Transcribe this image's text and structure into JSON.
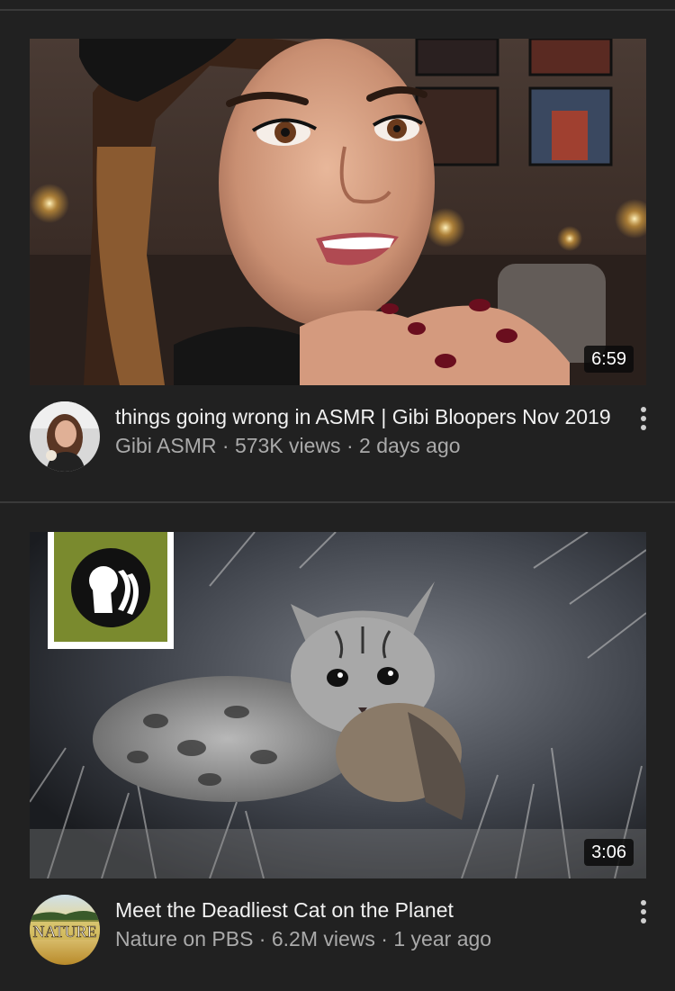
{
  "videos": [
    {
      "title": "things going wrong in ASMR | Gibi Bloopers Nov 2019",
      "channel": "Gibi ASMR",
      "views": "573K views",
      "age": "2 days ago",
      "duration": "6:59",
      "separator": " · ",
      "avatar_icon": "channel-avatar-gibi",
      "menu_icon": "more-vert-icon"
    },
    {
      "title": "Meet the Deadliest Cat on the Planet",
      "channel": "Nature on PBS",
      "views": "6.2M views",
      "age": "1 year ago",
      "duration": "3:06",
      "separator": " · ",
      "avatar_text": "NATURE",
      "avatar_icon": "channel-avatar-nature",
      "menu_icon": "more-vert-icon"
    }
  ],
  "colors": {
    "background": "#212121",
    "title": "#f1f1f1",
    "subtitle": "#aaaaaa",
    "pbs_green": "#7a8a2e"
  }
}
